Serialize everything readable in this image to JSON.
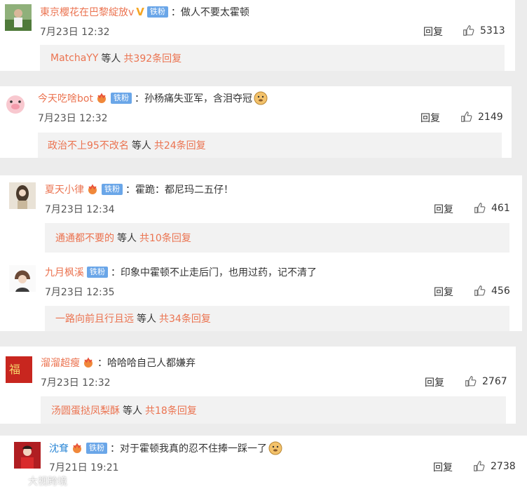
{
  "comments": [
    {
      "user": "東京櫻花在巴黎綻放v",
      "badge": "V",
      "fan": "铁粉",
      "text": "做人不要太霍顿",
      "time": "7月23日 12:32",
      "reply": "回复",
      "likes": "5313",
      "sub_user": "MatchaYY",
      "sub_deng": "等人",
      "sub_count": "共392条回复"
    },
    {
      "user": "今天吃啥bot",
      "fan": "铁粉",
      "text": "孙杨痛失亚军，含泪夺冠",
      "time": "7月23日 12:32",
      "reply": "回复",
      "likes": "2149",
      "sub_user": "政治不上95不改名",
      "sub_deng": "等人",
      "sub_count": "共24条回复"
    },
    {
      "user": "夏天小律",
      "fan": "铁粉",
      "text": "霍跪：都尼玛二五仔！",
      "time": "7月23日 12:34",
      "reply": "回复",
      "likes": "461",
      "sub_user": "通通都不要的",
      "sub_deng": "等人",
      "sub_count": "共10条回复"
    },
    {
      "user": "九月枫溪",
      "fan": "铁粉",
      "text": "印象中霍顿不止走后门，也用过药，记不清了",
      "time": "7月23日 12:35",
      "reply": "回复",
      "likes": "456",
      "sub_user": "一路向前且行且远",
      "sub_deng": "等人",
      "sub_count": "共34条回复"
    },
    {
      "user": "溜溜超瘦",
      "text": "哈哈哈自己人都嫌弃",
      "time": "7月23日 12:32",
      "reply": "回复",
      "likes": "2767",
      "sub_user": "汤圆蛋挞凤梨酥",
      "sub_deng": "等人",
      "sub_count": "共18条回复"
    },
    {
      "user": "沈耷",
      "fan": "铁粉",
      "text": "对于霍顿我真的忍不住捧一踩一了",
      "time": "7月21日 19:21",
      "reply": "回复",
      "likes": "2738"
    }
  ],
  "watermark": "大视跨境",
  "colors": {
    "username": "#eb7350",
    "fan_badge": "#6aa6e8",
    "sub_bg": "#f2f2f2",
    "page_bg": "#ececec"
  }
}
